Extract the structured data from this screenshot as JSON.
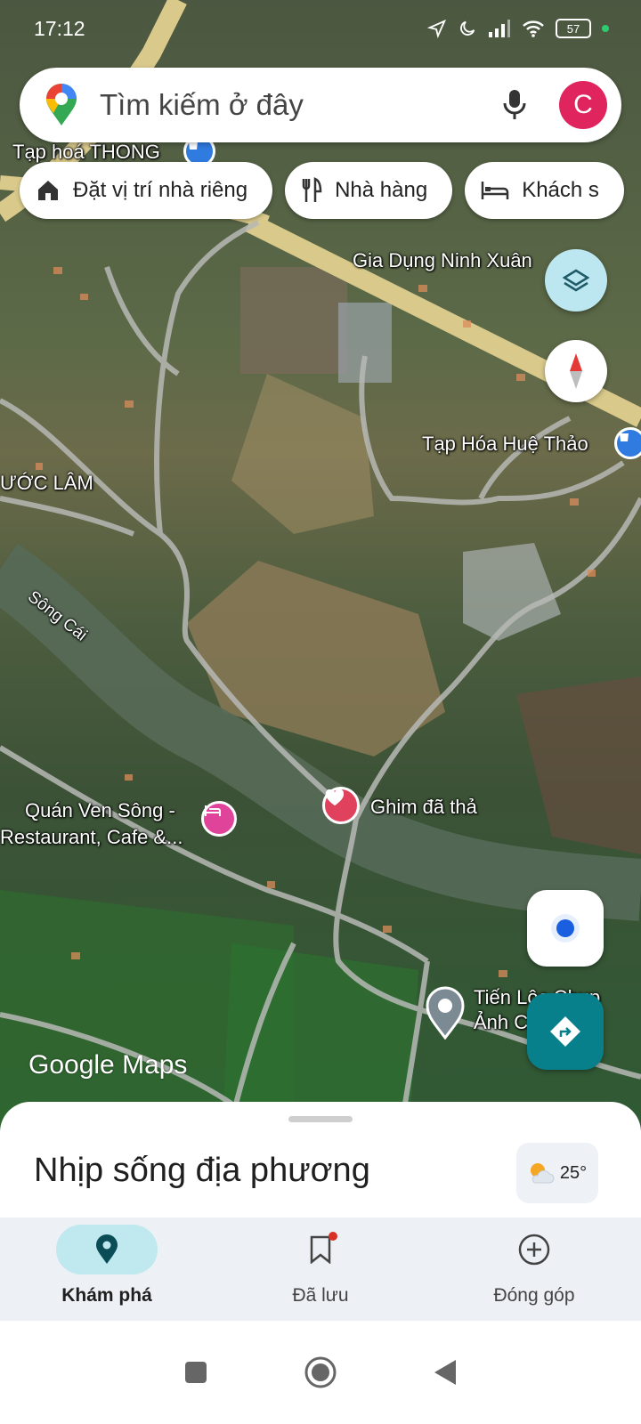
{
  "status_bar": {
    "time": "17:12",
    "battery": "57"
  },
  "search": {
    "placeholder": "Tìm kiếm ở đây",
    "avatar_letter": "C"
  },
  "chips": [
    {
      "label": "Đặt vị trí nhà riêng",
      "icon": "home-icon"
    },
    {
      "label": "Nhà hàng",
      "icon": "restaurant-icon"
    },
    {
      "label": "Khách s",
      "icon": "hotel-icon"
    }
  ],
  "map_labels": {
    "tap_hoa_thong": "Tạp hoá THONG",
    "gia_dung": "Gia Dụng Ninh Xuân",
    "tap_hoa_hue_thao": "Tạp Hóa Huệ Thảo",
    "uoc_lam": "ƯỚC LÂM",
    "song_cai": "Sông Cái",
    "quan_ven_song_1": "Quán Ven Sông -",
    "quan_ven_song_2": "Restaurant, Cafe &...",
    "ghim": "Ghim đã thả",
    "tien_loc_1": "Tiến Lộc Chụp",
    "tien_loc_2": "Ảnh C...   h H"
  },
  "google_logo": "Google Maps",
  "sheet": {
    "title": "Nhịp sống địa phương",
    "temperature": "25°"
  },
  "bottom_nav": [
    {
      "label": "Khám phá",
      "icon": "explore-pin-icon",
      "active": true
    },
    {
      "label": "Đã lưu",
      "icon": "bookmark-icon",
      "active": false
    },
    {
      "label": "Đóng góp",
      "icon": "add-circle-icon",
      "active": false
    }
  ],
  "colors": {
    "accent": "#07808c",
    "active_tab_bg": "#bfe9ef",
    "avatar": "#e0245e",
    "my_location": "#1a5fe0"
  }
}
